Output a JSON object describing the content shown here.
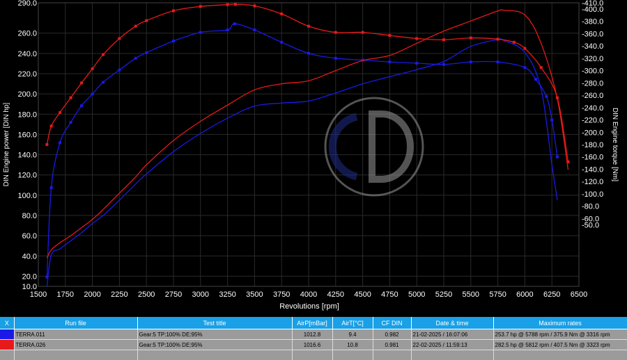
{
  "chart_data": {
    "type": "line",
    "xlabel": "Revolutions [rpm]",
    "ylabel_left": "DIN Engine power [DIN hp]",
    "ylabel_right": "DIN Engine torque [Nm]",
    "xlim": [
      1500,
      6500
    ],
    "ylim_left": [
      10,
      290
    ],
    "ylim_right": [
      -50,
      410
    ],
    "x_ticks": [
      1500,
      1750,
      2000,
      2250,
      2500,
      2750,
      3000,
      3250,
      3500,
      3750,
      4000,
      4250,
      4500,
      4750,
      5000,
      5250,
      5500,
      5750,
      6000,
      6250,
      6500
    ],
    "y_left_ticks": [
      "10.0",
      "20.0",
      "40.0",
      "60.0",
      "80.0",
      "100.0",
      "120.0",
      "140.0",
      "160.0",
      "180.0",
      "200.0",
      "220.0",
      "240.0",
      "260.0",
      "290.0"
    ],
    "y_left_tick_values": [
      10,
      20,
      40,
      60,
      80,
      100,
      120,
      140,
      160,
      180,
      200,
      220,
      240,
      260,
      290
    ],
    "y_right_ticks": [
      "-50.0",
      "-60.0",
      "-80.0",
      "-100.0",
      "-120.0",
      "-140.0",
      "-160.0",
      "-180.0",
      "-200.0",
      "-220.0",
      "-240.0",
      "-260.0",
      "-280.0",
      "-300.0",
      "-320.0",
      "-340.0",
      "-360.0",
      "-380.0",
      "-400.0",
      "-410.0"
    ],
    "y_right_tick_values": [
      50,
      60,
      80,
      100,
      120,
      140,
      160,
      180,
      200,
      220,
      240,
      260,
      280,
      300,
      320,
      340,
      360,
      380,
      400,
      410
    ],
    "grid": true,
    "series": [
      {
        "name": "TERRA.011",
        "color": "#1a1ae6",
        "kind": "power",
        "axis": "left",
        "x": [
          1580,
          1620,
          1700,
          1800,
          1900,
          2000,
          2100,
          2250,
          2400,
          2500,
          2750,
          3000,
          3250,
          3500,
          3750,
          4000,
          4250,
          4500,
          4750,
          5000,
          5250,
          5500,
          5750,
          5800,
          6000,
          6150,
          6250,
          6300
        ],
        "y": [
          10,
          41,
          47,
          55,
          63,
          72,
          80,
          95,
          111,
          121,
          143,
          161,
          176,
          188,
          191,
          193,
          201,
          210,
          217,
          224,
          232,
          247,
          253.7,
          253,
          241,
          205,
          130,
          95
        ]
      },
      {
        "name": "TERRA.011",
        "color": "#1a1ae6",
        "kind": "torque",
        "axis": "right",
        "x": [
          1580,
          1620,
          1700,
          1800,
          1900,
          2000,
          2100,
          2250,
          2400,
          2500,
          2750,
          3000,
          3250,
          3316,
          3500,
          3750,
          4000,
          4250,
          4500,
          4750,
          5000,
          5250,
          5500,
          5750,
          6000,
          6100,
          6200,
          6250,
          6300
        ],
        "y": [
          -35,
          110,
          183,
          216,
          243,
          262,
          281,
          301,
          320,
          329,
          348,
          362,
          366,
          375.9,
          366,
          346,
          328,
          320,
          317,
          314,
          312,
          310,
          314,
          314,
          305,
          286,
          258,
          220,
          160
        ]
      },
      {
        "name": "TERRA.026",
        "color": "#e61a1a",
        "kind": "power",
        "axis": "left",
        "x": [
          1580,
          1620,
          1700,
          1800,
          1900,
          2000,
          2100,
          2250,
          2400,
          2500,
          2750,
          3000,
          3250,
          3500,
          3750,
          4000,
          4250,
          4500,
          4750,
          5000,
          5250,
          5500,
          5750,
          5812,
          6000,
          6150,
          6300,
          6400
        ],
        "y": [
          38,
          46,
          53,
          60,
          68,
          76,
          86,
          102,
          118,
          130,
          154,
          173,
          189,
          204,
          210,
          213,
          223,
          233,
          238,
          250,
          262,
          272,
          282,
          282.5,
          278,
          250,
          195,
          125
        ]
      },
      {
        "name": "TERRA.026",
        "color": "#e61a1a",
        "kind": "torque",
        "axis": "right",
        "x": [
          1580,
          1620,
          1700,
          1800,
          1900,
          2000,
          2100,
          2250,
          2400,
          2500,
          2750,
          3000,
          3250,
          3323,
          3500,
          3750,
          4000,
          4250,
          4500,
          4750,
          5000,
          5250,
          5500,
          5750,
          5900,
          6000,
          6150,
          6300,
          6400
        ],
        "y": [
          180,
          210,
          232,
          256,
          280,
          303,
          326,
          352,
          372,
          381,
          397,
          404,
          407,
          407.5,
          405,
          392,
          372,
          362,
          362,
          357,
          352,
          350,
          353,
          351,
          346,
          336,
          305,
          256,
          152
        ]
      }
    ]
  },
  "table": {
    "headers": [
      "X",
      "Run file",
      "Test title",
      "AirP[mBar]",
      "AirT[°C]",
      "CF DIN",
      "Date & time",
      "Maximum rates"
    ],
    "rows": [
      {
        "color": "#1a1ae6",
        "run_file": "TERRA.011",
        "test_title": "Gear:5 TP:100% DE:95%",
        "airp": "1012.8",
        "airt": "9.4",
        "cf": "0.982",
        "datetime": "21-02-2025 / 16:07:06",
        "max": "253.7 hp @ 5788 rpm / 375.9 Nm @ 3316 rpm"
      },
      {
        "color": "#e61a1a",
        "run_file": "TERRA.026",
        "test_title": "Gear:5 TP:100% DE:95%",
        "airp": "1016.6",
        "airt": "10.8",
        "cf": "0.981",
        "datetime": "22-02-2025 / 11:59:13",
        "max": "282.5 hp @ 5812 rpm / 407.5 Nm @ 3323 rpm"
      },
      {
        "color": "",
        "run_file": "",
        "test_title": "",
        "airp": "",
        "airt": "",
        "cf": "",
        "datetime": "",
        "max": ""
      }
    ]
  }
}
